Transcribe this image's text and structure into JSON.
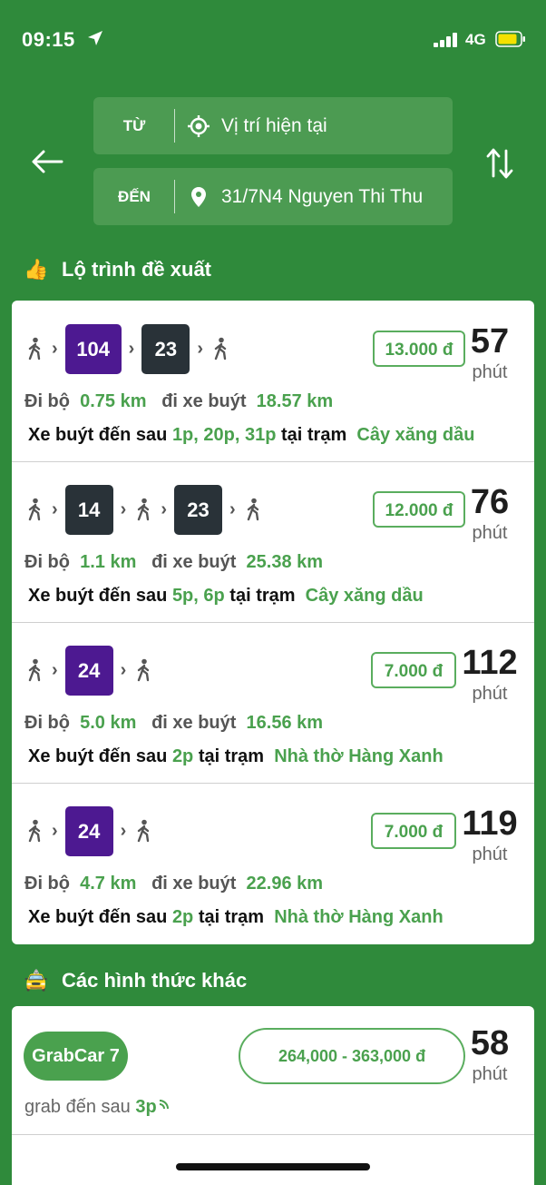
{
  "status_bar": {
    "time": "09:15",
    "network": "4G"
  },
  "header": {
    "from_label": "TỪ",
    "from_value": "Vị trí hiện tại",
    "to_label": "ĐẾN",
    "to_value": "31/7N4 Nguyen Thi Thu"
  },
  "suggested": {
    "title": "Lộ trình đề xuất",
    "walk_label": "Đi bộ",
    "bus_label": "đi xe buýt",
    "arrive_prefix": "Xe buýt đến sau",
    "at_station": "tại trạm",
    "minute_unit": "phút",
    "routes": [
      {
        "bus1": "104",
        "bus2": "23",
        "price": "13.000 đ",
        "minutes": "57",
        "walk": "0.75 km",
        "bus_dist": "18.57 km",
        "times": "1p, 20p, 31p",
        "station": "Cây xăng dầu"
      },
      {
        "bus1": "14",
        "bus2": "23",
        "price": "12.000 đ",
        "minutes": "76",
        "walk": "1.1 km",
        "bus_dist": "25.38 km",
        "times": "5p, 6p",
        "station": "Cây xăng dầu"
      },
      {
        "bus1": "24",
        "price": "7.000 đ",
        "minutes": "112",
        "walk": "5.0 km",
        "bus_dist": "16.56 km",
        "times": "2p",
        "station": "Nhà thờ Hàng Xanh"
      },
      {
        "bus1": "24",
        "price": "7.000 đ",
        "minutes": "119",
        "walk": "4.7 km",
        "bus_dist": "22.96 km",
        "times": "2p",
        "station": "Nhà thờ Hàng Xanh"
      }
    ]
  },
  "other": {
    "title": "Các hình thức khác",
    "grab": {
      "name": "GrabCar 7",
      "price_range": "264,000 - 363,000 đ",
      "minutes": "58",
      "unit": "phút",
      "eta_prefix": "grab đến sau",
      "eta": "3p"
    }
  },
  "colors": {
    "background": "#2f8a3b",
    "accent": "#4aa14e",
    "bus_purple": "#4d1991",
    "bus_dark": "#293238"
  }
}
